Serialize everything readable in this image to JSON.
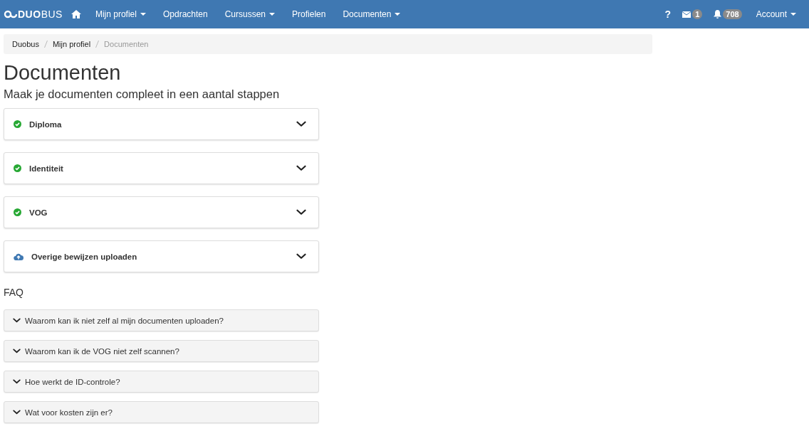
{
  "navbar": {
    "logo": "**DUO**BUS",
    "items": [
      {
        "label": "Mijn profiel",
        "dropdown": true
      },
      {
        "label": "Opdrachten",
        "dropdown": false
      },
      {
        "label": "Cursussen",
        "dropdown": true
      },
      {
        "label": "Profielen",
        "dropdown": false
      },
      {
        "label": "Documenten",
        "dropdown": true
      }
    ],
    "help": "?",
    "messages_count": "1",
    "notifications_count": "708",
    "account": {
      "label": "Account",
      "dropdown": true
    }
  },
  "breadcrumb": [
    {
      "label": "Duobus",
      "current": false
    },
    {
      "label": "Mijn profiel",
      "current": false
    },
    {
      "label": "Documenten",
      "current": true
    }
  ],
  "title": "Documenten",
  "subtitle": "Maak je documenten compleet in een aantal stappen",
  "documents": [
    {
      "label": "Diploma",
      "kind": "done",
      "expanded": false
    },
    {
      "label": "Identiteit",
      "kind": "done",
      "expanded": false
    },
    {
      "label": "VOG",
      "kind": "done",
      "expanded": false
    },
    {
      "label": "Overige bewijzen uploaden",
      "kind": "upload",
      "expanded": false
    }
  ],
  "faq_title": "FAQ",
  "faq": [
    {
      "question": "Waarom kan ik niet zelf al mijn documenten uploaden?",
      "expanded": false
    },
    {
      "question": "Waarom kan ik de VOG niet zelf scannen?",
      "expanded": false
    },
    {
      "question": "Hoe werkt de ID-controle?",
      "expanded": false
    },
    {
      "question": "Wat voor kosten zijn er?",
      "expanded": false
    }
  ]
}
